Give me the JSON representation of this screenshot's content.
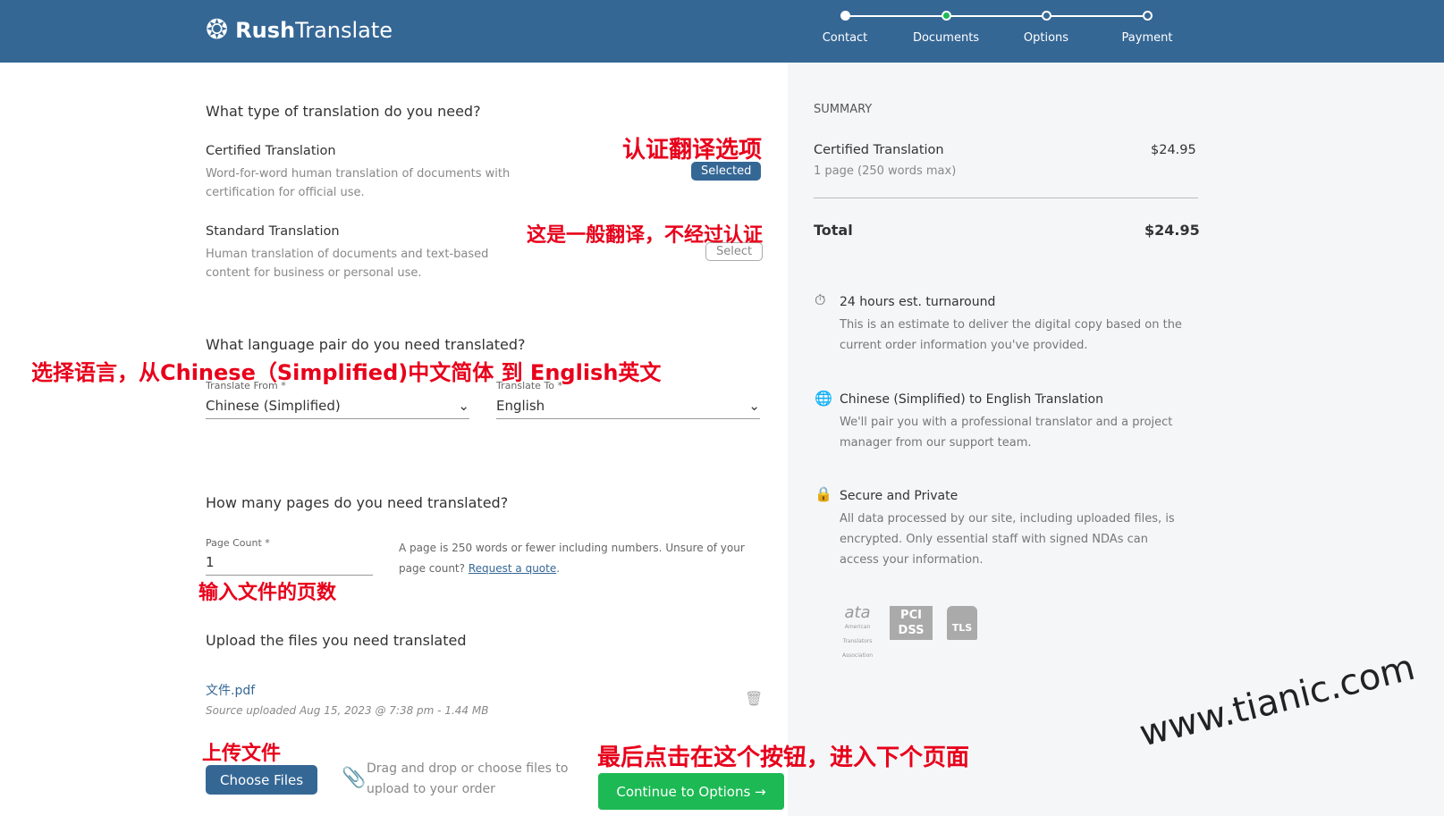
{
  "brand": {
    "name_bold": "Rush",
    "name_light": "Translate"
  },
  "steps": [
    {
      "label": "Contact",
      "state": "done"
    },
    {
      "label": "Documents",
      "state": "current"
    },
    {
      "label": "Options",
      "state": "todo"
    },
    {
      "label": "Payment",
      "state": "todo"
    }
  ],
  "type_section": {
    "title": "What type of translation do you need?",
    "options": [
      {
        "name": "Certified Translation",
        "desc1": "Word-for-word human translation of documents with",
        "desc2": "certification for official use.",
        "button": "Selected"
      },
      {
        "name": "Standard Translation",
        "desc1": "Human translation of documents and text-based",
        "desc2": "content for business or personal use.",
        "button": "Select"
      }
    ]
  },
  "lang_section": {
    "title": "What language pair do you need translated?",
    "from_label": "Translate From *",
    "from_value": "Chinese (Simplified)",
    "to_label": "Translate To *",
    "to_value": "English"
  },
  "pages_section": {
    "title": "How many pages do you need translated?",
    "label": "Page Count *",
    "value": "1",
    "help1": "A page is 250 words or fewer including numbers. Unsure of your",
    "help2": "page count?",
    "link": "Request a quote",
    "period": "."
  },
  "upload_section": {
    "title": "Upload the files you need translated",
    "file_name": "文件.pdf",
    "file_meta": "Source uploaded Aug 15, 2023 @ 7:38 pm - 1.44 MB",
    "choose": "Choose Files",
    "drag1": "Drag and drop or choose files to",
    "drag2": "upload to your order",
    "continue": "Continue to Options →"
  },
  "summary": {
    "heading": "SUMMARY",
    "item": "Certified Translation",
    "item_price": "$24.95",
    "item_detail": "1 page (250 words max)",
    "total_label": "Total",
    "total": "$24.95",
    "features": [
      {
        "icon": "stopwatch-icon",
        "title": "24 hours est. turnaround",
        "l1": "This is an estimate to deliver the digital copy based on the",
        "l2": "current order information you've provided.",
        "l3": ""
      },
      {
        "icon": "globe-icon",
        "title": "Chinese (Simplified) to English Translation",
        "l1": "We'll pair you with a professional translator and a project",
        "l2": "manager from our support team.",
        "l3": ""
      },
      {
        "icon": "lock-icon",
        "title": "Secure and Private",
        "l1": "All data processed by our site, including uploaded files, is",
        "l2": "encrypted. Only essential staff with signed NDAs can",
        "l3": "access your information."
      }
    ],
    "badges": [
      "ata American Translators Association",
      "PCI DSS",
      "TLS"
    ]
  },
  "annotations": {
    "certified": "认证翻译选项",
    "standard": "这是一般翻译，不经过认证",
    "language": "选择语言，从Chinese（Simplified)中文简体 到 English英文",
    "pages": "输入文件的页数",
    "upload": "上传文件",
    "continue": "最后点击在这个按钮，进入下个页面"
  },
  "watermark": "www.tianic.com",
  "colors": {
    "header": "#356795",
    "accent_green": "#1db954",
    "annotation_red": "#e8001b"
  }
}
